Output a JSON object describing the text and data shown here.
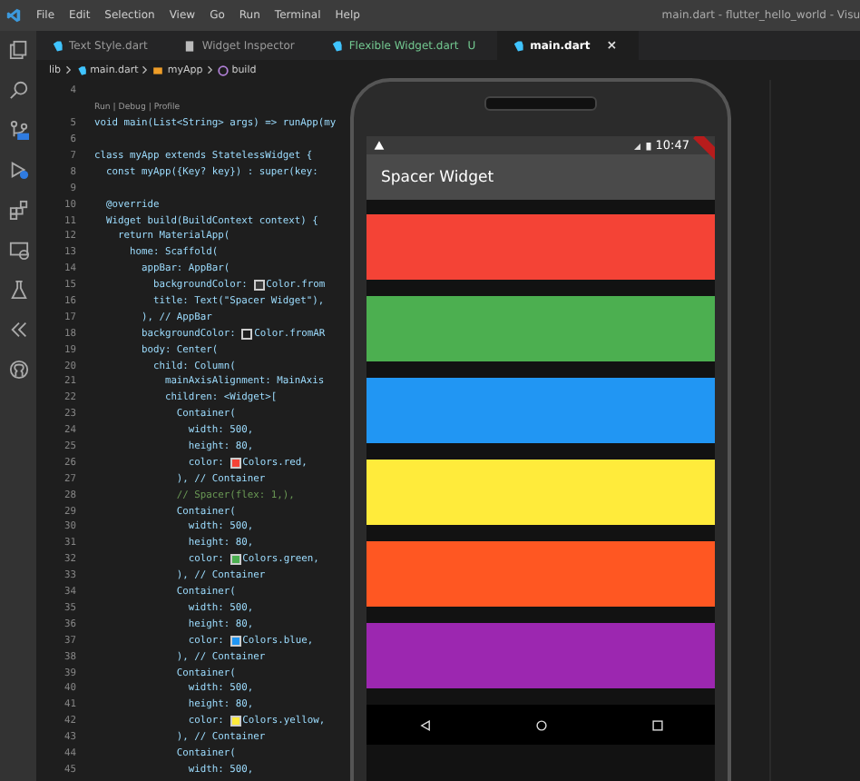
{
  "menu": [
    "File",
    "Edit",
    "Selection",
    "View",
    "Go",
    "Run",
    "Terminal",
    "Help"
  ],
  "window": {
    "title": "main.dart - flutter_hello_world - Visu"
  },
  "tabs": [
    {
      "label": "Text Style.dart",
      "selected": false,
      "modified": false,
      "kind": "dart"
    },
    {
      "label": "Widget Inspector",
      "selected": false,
      "modified": false,
      "kind": "inspector"
    },
    {
      "label": "Flexible Widget.dart",
      "selected": false,
      "modified": true,
      "badge": "U",
      "kind": "dart"
    },
    {
      "label": "main.dart",
      "selected": true,
      "modified": false,
      "close": "×",
      "kind": "dart"
    }
  ],
  "breadcrumb": [
    {
      "label": "lib",
      "kind": "folder"
    },
    {
      "label": "main.dart",
      "kind": "dart"
    },
    {
      "label": "myApp",
      "kind": "class"
    },
    {
      "label": "build",
      "kind": "method"
    }
  ],
  "codelens": "Run | Debug | Profile",
  "lines": [
    {
      "number": "4",
      "kind": "code"
    },
    {
      "number": "5",
      "text": "void main(List<String> args) => runApp(my",
      "kind": "code"
    },
    {
      "number": "6",
      "kind": "code"
    },
    {
      "number": "7",
      "text": "class myApp extends StatelessWidget {",
      "kind": "code"
    },
    {
      "number": "8",
      "text": "  const myApp({Key? key}) : super(key:",
      "kind": "code"
    },
    {
      "number": "9",
      "kind": "code"
    },
    {
      "number": "10",
      "text": "  @override",
      "kind": "code"
    },
    {
      "number": "11",
      "text": "  Widget build(BuildContext context) {",
      "kind": "code"
    },
    {
      "number": "12",
      "text": "    return MaterialApp(",
      "kind": "code"
    },
    {
      "number": "13",
      "text": "      home: Scaffold(",
      "kind": "code"
    },
    {
      "number": "14",
      "text": "        appBar: AppBar(",
      "kind": "code"
    },
    {
      "number": "15",
      "text": "          backgroundColor: ",
      "color": "#3a3a3a",
      "after": "Color.from",
      "kind": "code"
    },
    {
      "number": "16",
      "text": "          title: Text(\"Spacer Widget\"),",
      "kind": "code"
    },
    {
      "number": "17",
      "text": "        ), // AppBar",
      "kind": "code"
    },
    {
      "number": "18",
      "text": "        backgroundColor: ",
      "color": "#1e1e1e",
      "after": "Color.fromAR",
      "kind": "code"
    },
    {
      "number": "19",
      "text": "        body: Center(",
      "kind": "code"
    },
    {
      "number": "20",
      "text": "          child: Column(",
      "kind": "code"
    },
    {
      "number": "21",
      "text": "            mainAxisAlignment: MainAxis",
      "kind": "code"
    },
    {
      "number": "22",
      "text": "            children: <Widget>[",
      "kind": "code"
    },
    {
      "number": "23",
      "text": "              Container(",
      "kind": "code"
    },
    {
      "number": "24",
      "text": "                width: 500,",
      "kind": "code"
    },
    {
      "number": "25",
      "text": "                height: 80,",
      "kind": "code"
    },
    {
      "number": "26",
      "text": "                color: ",
      "color": "#f44336",
      "after": "Colors.red,",
      "kind": "code"
    },
    {
      "number": "27",
      "text": "              ), // Container",
      "kind": "code"
    },
    {
      "number": "28",
      "text": "              // Spacer(flex: 1,),",
      "kind": "comment"
    },
    {
      "number": "29",
      "text": "              Container(",
      "kind": "code"
    },
    {
      "number": "30",
      "text": "                width: 500,",
      "kind": "code"
    },
    {
      "number": "31",
      "text": "                height: 80,",
      "kind": "code"
    },
    {
      "number": "32",
      "text": "                color: ",
      "color": "#4caf50",
      "after": "Colors.green,",
      "kind": "code"
    },
    {
      "number": "33",
      "text": "              ), // Container",
      "kind": "code"
    },
    {
      "number": "34",
      "text": "              Container(",
      "kind": "code"
    },
    {
      "number": "35",
      "text": "                width: 500,",
      "kind": "code"
    },
    {
      "number": "36",
      "text": "                height: 80,",
      "kind": "code"
    },
    {
      "number": "37",
      "text": "                color: ",
      "color": "#2196f3",
      "after": "Colors.blue,",
      "kind": "code"
    },
    {
      "number": "38",
      "text": "              ), // Container",
      "kind": "code"
    },
    {
      "number": "39",
      "text": "              Container(",
      "kind": "code"
    },
    {
      "number": "40",
      "text": "                width: 500,",
      "kind": "code"
    },
    {
      "number": "41",
      "text": "                height: 80,",
      "kind": "code"
    },
    {
      "number": "42",
      "text": "                color: ",
      "color": "#ffeb3b",
      "after": "Colors.yellow,",
      "kind": "code"
    },
    {
      "number": "43",
      "text": "              ), // Container",
      "kind": "code"
    },
    {
      "number": "44",
      "text": "              Container(",
      "kind": "code"
    },
    {
      "number": "45",
      "text": "                width: 500,",
      "kind": "code"
    }
  ],
  "phone": {
    "time": "10:47",
    "app_title": "Spacer Widget",
    "bars": [
      {
        "color": "#f44336"
      },
      {
        "color": "#4caf50"
      },
      {
        "color": "#2196f3"
      },
      {
        "color": "#ffeb3b"
      },
      {
        "color": "#ff5722"
      },
      {
        "color": "#9c27b0"
      }
    ]
  }
}
